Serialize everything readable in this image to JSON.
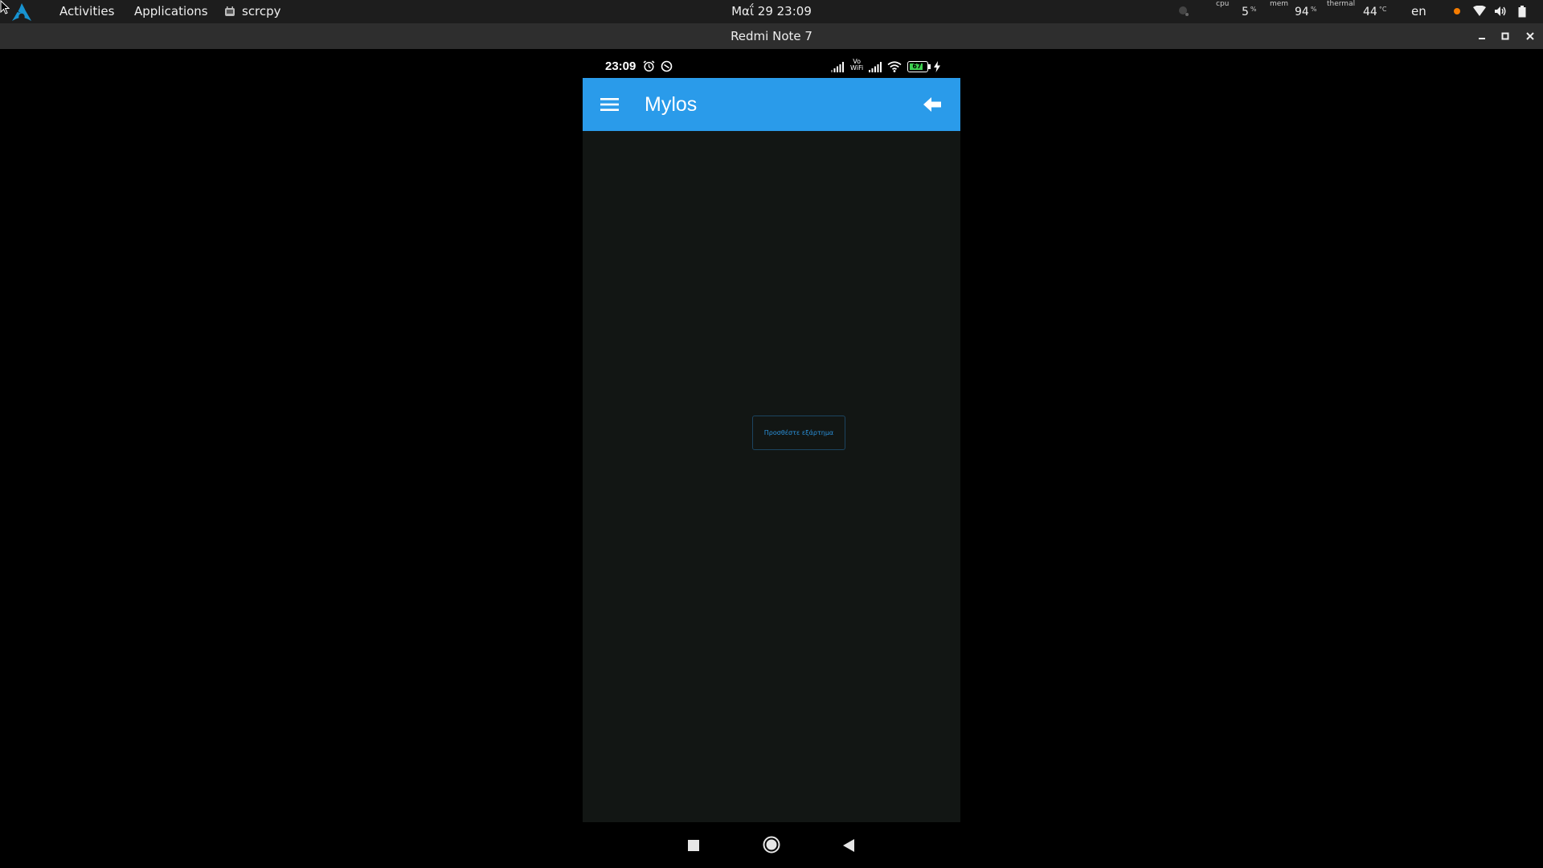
{
  "topbar": {
    "activities": "Activities",
    "applications": "Applications",
    "app_name": "scrcpy",
    "datetime": "Μαΐ 29  23:09",
    "cpu_label": "cpu",
    "cpu_value": "5",
    "mem_label": "mem",
    "mem_value": "94",
    "thermal_label": "thermal",
    "thermal_value": "44",
    "percent_unit": "%",
    "temp_unit": "°C",
    "language": "en"
  },
  "window": {
    "title": "Redmi Note 7"
  },
  "phone": {
    "status": {
      "time": "23:09",
      "battery": "67",
      "volte_line1": "Vo",
      "volte_line2": "WiFi"
    },
    "appbar": {
      "title": "Mylos"
    },
    "content": {
      "add_button_label": "Προσθέστε εξάρτημα"
    }
  },
  "colors": {
    "accent": "#2a9bea",
    "content_bg": "#121614",
    "button_text": "#2a8fd8",
    "notification_dot": "#f57c00"
  }
}
